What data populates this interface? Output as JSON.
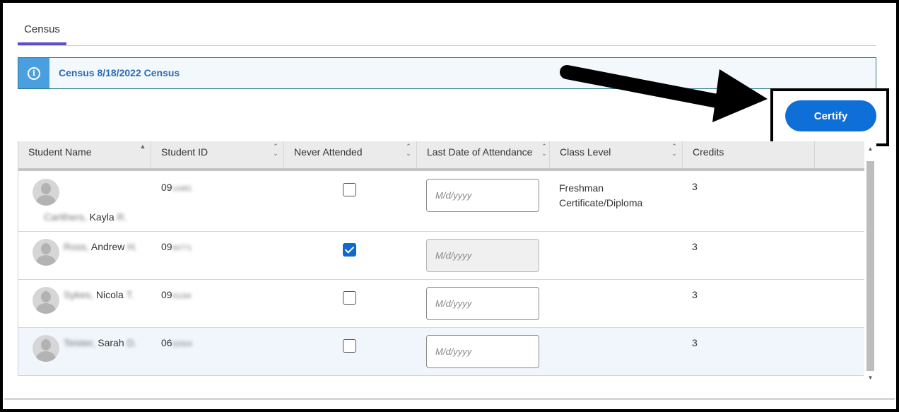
{
  "tabs": [
    {
      "label": "Census",
      "active": true
    }
  ],
  "banner": {
    "icon": "info-icon",
    "text": "Census 8/18/2022 Census"
  },
  "actions": {
    "certify_label": "Certify"
  },
  "table": {
    "columns": [
      "Student Name",
      "Student ID",
      "Never Attended",
      "Last Date of Attendance",
      "Class Level",
      "Credits"
    ],
    "rows": [
      {
        "name_prefix": "Carithers,",
        "name_given": "Kayla",
        "name_suffix": "R.",
        "id_prefix": "09",
        "id_rest": "14481",
        "never_attended": false,
        "date_placeholder": "M/d/yyyy",
        "date_disabled": false,
        "class_level_1": "Freshman",
        "class_level_2": "Certificate/Diploma",
        "credits": "3"
      },
      {
        "name_prefix": "Ross,",
        "name_given": "Andrew",
        "name_suffix": "H.",
        "id_prefix": "09",
        "id_rest": "60771",
        "never_attended": true,
        "date_placeholder": "M/d/yyyy",
        "date_disabled": true,
        "class_level_1": "",
        "class_level_2": "",
        "credits": "3"
      },
      {
        "name_prefix": "Sykes,",
        "name_given": "Nicola",
        "name_suffix": "T.",
        "id_prefix": "09",
        "id_rest": "61184",
        "never_attended": false,
        "date_placeholder": "M/d/yyyy",
        "date_disabled": false,
        "class_level_1": "",
        "class_level_2": "",
        "credits": "3"
      },
      {
        "name_prefix": "Teister,",
        "name_given": "Sarah",
        "name_suffix": "D.",
        "id_prefix": "06",
        "id_rest": "32004",
        "never_attended": false,
        "date_placeholder": "M/d/yyyy",
        "date_disabled": false,
        "class_level_1": "",
        "class_level_2": "",
        "credits": "3"
      }
    ]
  },
  "colors": {
    "accent": "#0e6fd8",
    "tab_underline": "#5a4fd0",
    "banner_icon_bg": "#4a9fe0",
    "banner_text": "#2a6bb3"
  }
}
